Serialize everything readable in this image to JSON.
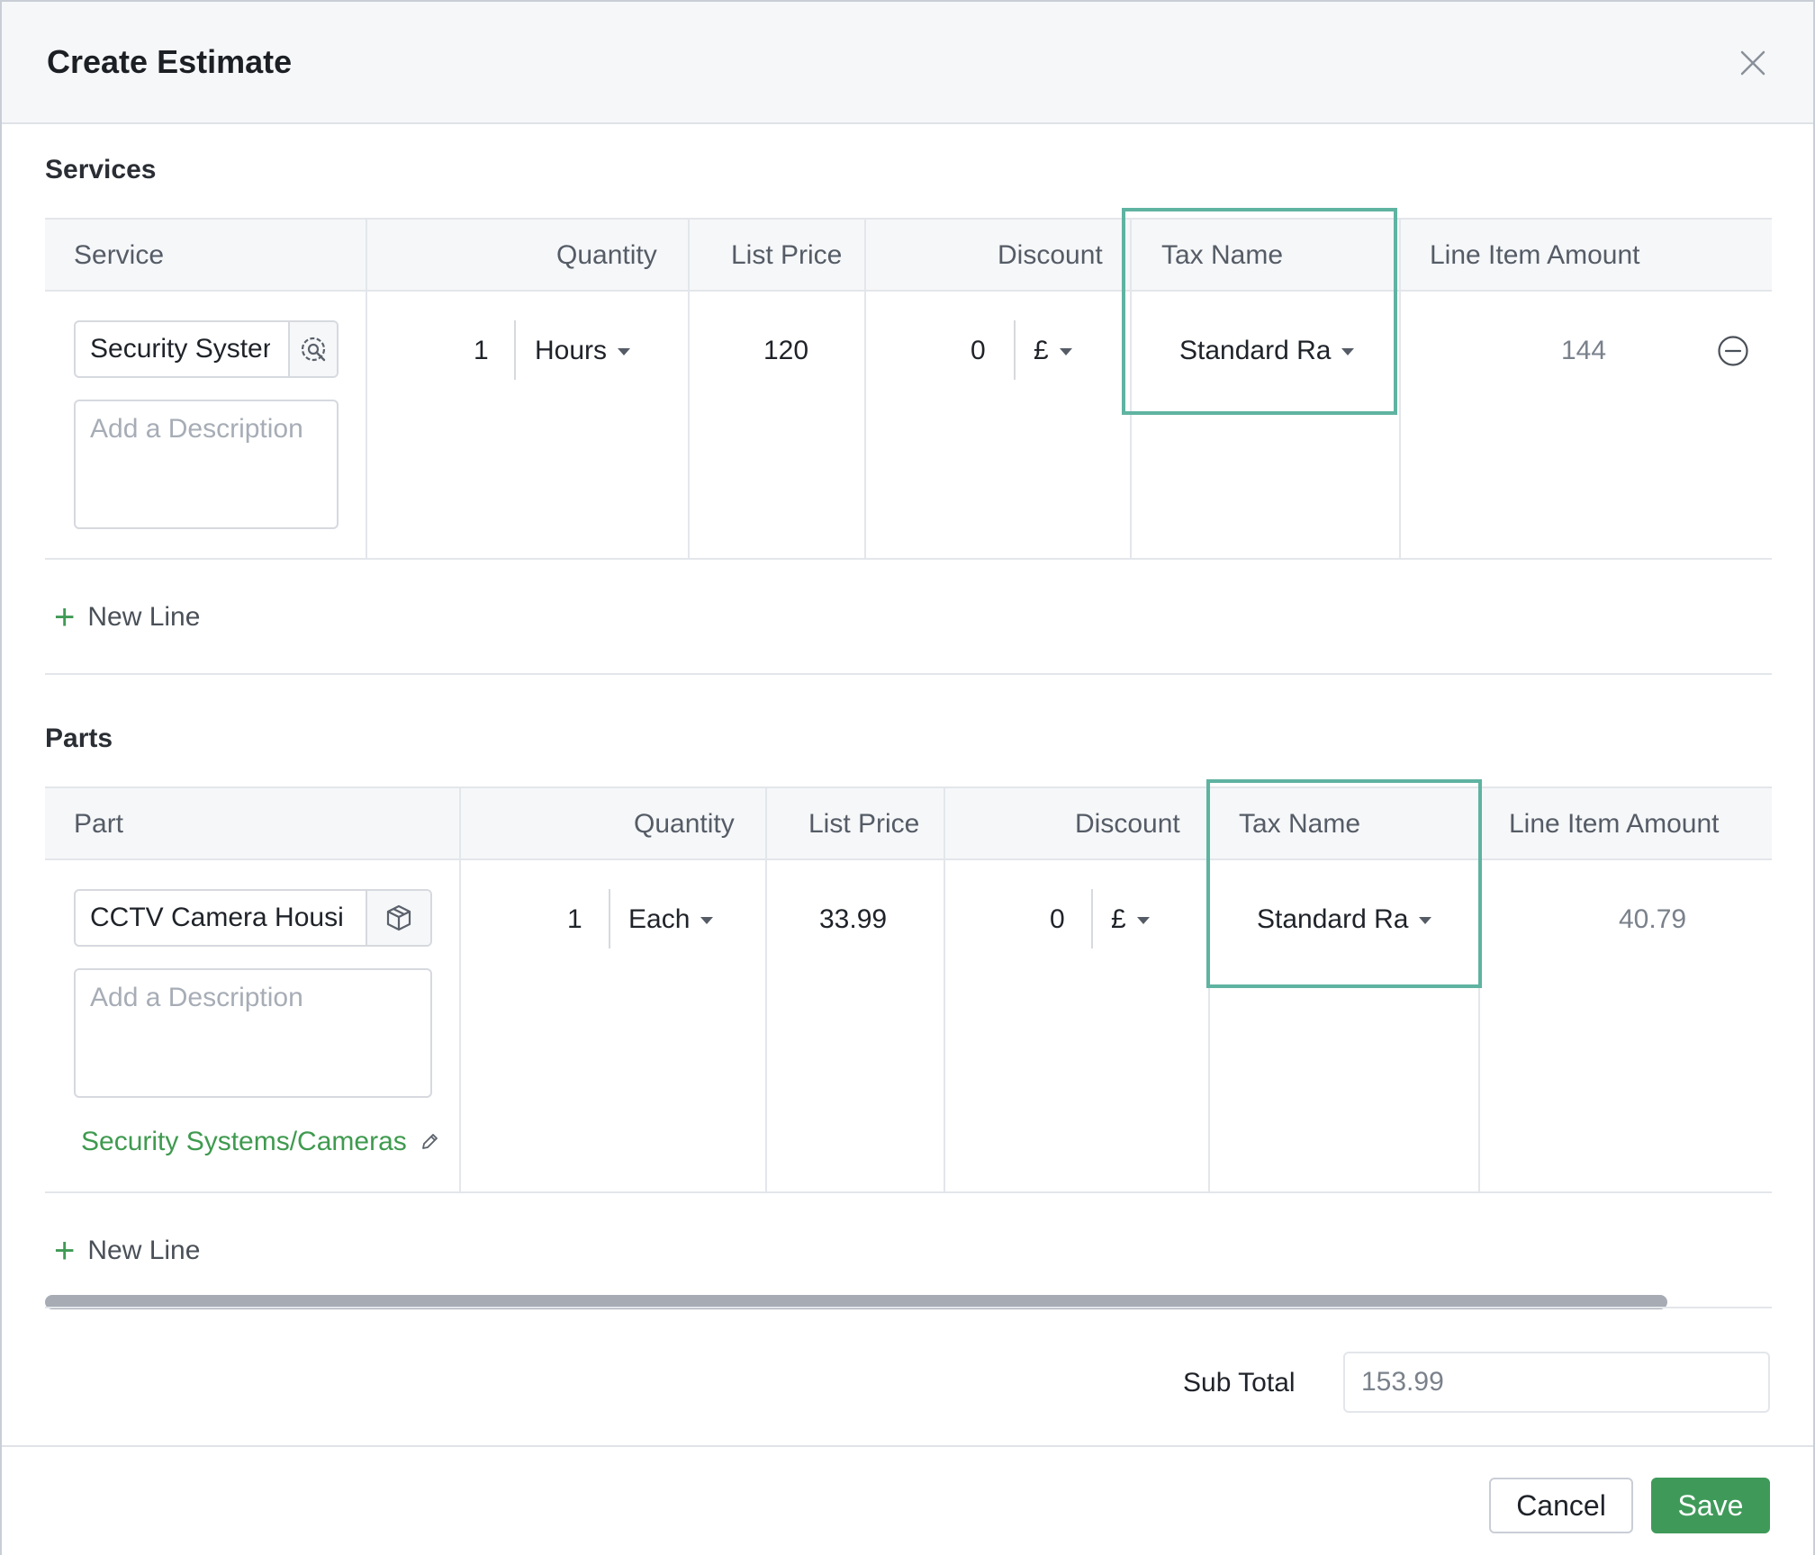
{
  "dialog": {
    "title": "Create Estimate"
  },
  "services": {
    "section_title": "Services",
    "columns": {
      "item": "Service",
      "quantity": "Quantity",
      "list_price": "List Price",
      "discount": "Discount",
      "tax_name": "Tax Name",
      "line_item_amount": "Line Item Amount"
    },
    "row": {
      "item_value": "Security System",
      "description_placeholder": "Add a Description",
      "quantity": "1",
      "unit": "Hours",
      "list_price": "120",
      "discount": "0",
      "discount_type": "£",
      "tax_name": "Standard Ra",
      "line_item_amount": "144"
    },
    "new_line_label": "New Line"
  },
  "parts": {
    "section_title": "Parts",
    "columns": {
      "item": "Part",
      "quantity": "Quantity",
      "list_price": "List Price",
      "discount": "Discount",
      "tax_name": "Tax Name",
      "line_item_amount": "Line Item Amount"
    },
    "row": {
      "item_value": "CCTV Camera Housing",
      "description_placeholder": "Add a Description",
      "quantity": "1",
      "unit": "Each",
      "list_price": "33.99",
      "discount": "0",
      "discount_type": "£",
      "tax_name": "Standard Ra",
      "line_item_amount": "40.79",
      "category": "Security Systems/Cameras"
    },
    "new_line_label": "New Line"
  },
  "totals": {
    "sub_total_label": "Sub Total",
    "sub_total_value": "153.99"
  },
  "footer": {
    "cancel_label": "Cancel",
    "save_label": "Save"
  },
  "colors": {
    "accent_green": "#3f9a5a",
    "highlight_teal": "#5fb3a1"
  },
  "icons": [
    "close-icon",
    "wrench-gear-icon",
    "cube-icon",
    "remove-circle-icon",
    "plus-icon",
    "pencil-icon",
    "caret-down-icon"
  ]
}
